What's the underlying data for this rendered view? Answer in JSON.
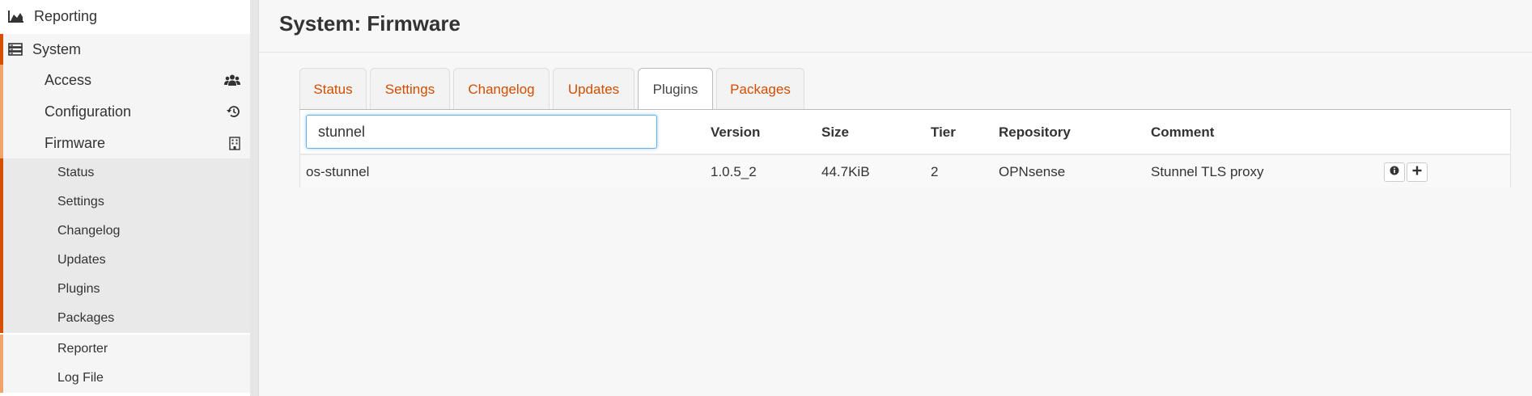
{
  "sidebar": {
    "reporting": {
      "label": "Reporting",
      "icon": "area-chart-icon"
    },
    "system": {
      "label": "System",
      "icon": "server-icon"
    },
    "access": {
      "label": "Access",
      "icon": "users-icon"
    },
    "configuration": {
      "label": "Configuration",
      "icon": "history-icon"
    },
    "firmware": {
      "label": "Firmware",
      "icon": "building-icon"
    },
    "firmware_items": [
      "Status",
      "Settings",
      "Changelog",
      "Updates",
      "Plugins",
      "Packages"
    ],
    "other_items": [
      "Reporter",
      "Log File"
    ]
  },
  "page": {
    "title": "System: Firmware"
  },
  "tabs": [
    "Status",
    "Settings",
    "Changelog",
    "Updates",
    "Plugins",
    "Packages"
  ],
  "active_tab": "Plugins",
  "search": {
    "value": "stunnel"
  },
  "table": {
    "headers": {
      "version": "Version",
      "size": "Size",
      "tier": "Tier",
      "repository": "Repository",
      "comment": "Comment"
    },
    "rows": [
      {
        "name": "os-stunnel",
        "version": "1.0.5_2",
        "size": "44.7KiB",
        "tier": "2",
        "repository": "OPNsense",
        "comment": "Stunnel TLS proxy"
      }
    ]
  },
  "colors": {
    "accent": "#d94f00",
    "accent_light": "#f0a36a",
    "link": "#d14d00"
  }
}
